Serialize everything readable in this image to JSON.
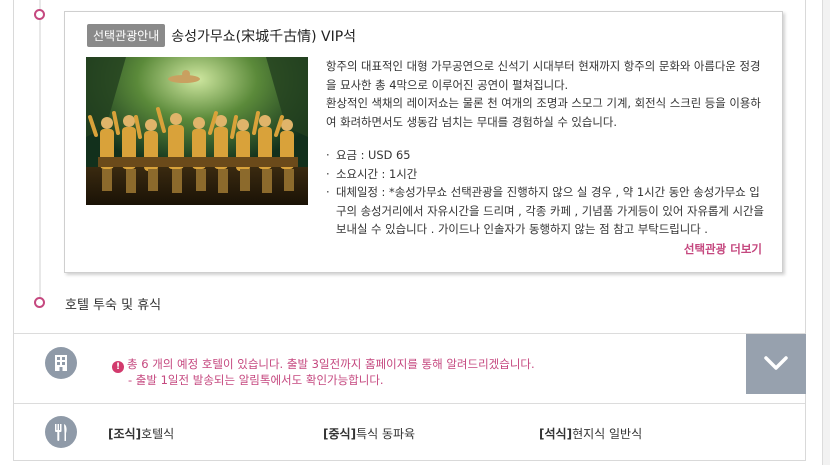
{
  "card": {
    "tag": "선택관광안내",
    "title": "송성가무쇼(宋城千古情) VIP석",
    "desc_1": "항주의 대표적인 대형 가무공연으로 신석기 시대부터 현재까지 항주의 문화와 아름다운 정경을 묘사한 총 4막으로 이루어진 공연이 펼쳐집니다.",
    "desc_2": "환상적인 색채의 레이저쇼는 물론 천 여개의 조명과 스모그 기계, 회전식 스크린 등을 이용하여 화려하면서도 생동감 넘치는 무대를 경험하실 수 있습니다.",
    "info": [
      "요금 : USD 65",
      "소요시간 : 1시간",
      "대체일정 : *송성가무쇼 선택관광을 진행하지 않으 실 경우 , 약 1시간 동안 송성가무쇼 입구의 송성거리에서 자유시간을 드리며 , 각종 카페 , 기념품 가게등이 있어 자유롭게 시간을 보내실 수 있습니다 . 가이드나 인솔자가 동행하지 않는 점 참고 부탁드립니다 ."
    ],
    "more_link": "선택관광 더보기"
  },
  "timeline": {
    "hotel_label": "호텔 투숙 및 휴식"
  },
  "notice": {
    "icon": "building-icon",
    "line_1": "총 6 개의 예정 호텔이 있습니다. 출발 3일전까지 홈페이지를 통해 알려드리겠습니다.",
    "line_2": "- 출발 1일전 발송되는 알림톡에서도 확인가능합니다.",
    "expand_icon": "chevron-down-icon"
  },
  "meals": {
    "icon": "fork-knife-icon",
    "breakfast_tag": "[조식]",
    "breakfast": "호텔식",
    "lunch_tag": "[중식]",
    "lunch": "특식 동파육",
    "dinner_tag": "[석식]",
    "dinner": "현지식 일반식"
  },
  "colors": {
    "accent": "#c5487f",
    "icon_bg": "#8f9aa8",
    "tag_bg": "#8a8a8a"
  }
}
